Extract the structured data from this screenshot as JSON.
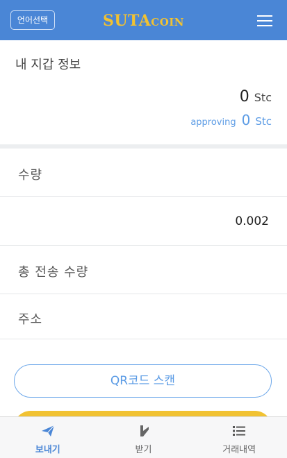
{
  "header": {
    "language_button": "언어선택",
    "brand_main": "SUTA",
    "brand_small": "COIN"
  },
  "wallet": {
    "title": "내 지갑 정보",
    "balance": "0",
    "unit": "Stc",
    "approving_label": "approving",
    "approving_value": "0",
    "approving_unit": "Stc"
  },
  "form": {
    "quantity_label": "수량",
    "quantity_value": "0.002",
    "total_label": "총 전송 수량",
    "address_label": "주소"
  },
  "qr_button": "QR코드 스캔",
  "tabbar": {
    "send": "보내기",
    "receive": "받기",
    "history": "거래내역"
  },
  "colors": {
    "header": "#4a86d6",
    "brand": "#f1c232",
    "accent": "#5b9be5"
  }
}
